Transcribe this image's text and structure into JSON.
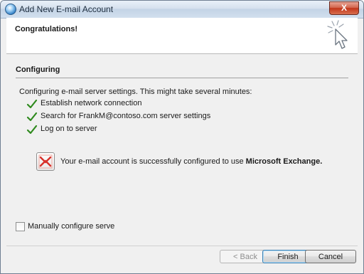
{
  "window": {
    "title": "Add New E-mail Account",
    "close_label": "X"
  },
  "header": {
    "title": "Congratulations!"
  },
  "section": {
    "title": "Configuring",
    "intro": "Configuring e-mail server settings.  This might take several minutes:"
  },
  "steps": [
    {
      "label": "Establish network connection",
      "status": "done"
    },
    {
      "label": "Search for FrankM@contoso.com server settings",
      "status": "done"
    },
    {
      "label": "Log on to server",
      "status": "done"
    }
  ],
  "result": {
    "text": "Your e-mail account is successfully configured to use ",
    "server": "Microsoft Exchange."
  },
  "manual": {
    "label": "Manually configure server settings",
    "checked": false
  },
  "buttons": {
    "back": "< Back",
    "finish": "Finish",
    "cancel": "Cancel"
  },
  "icons": {
    "app": "outlook-icon",
    "wizard": "wizard-sparkle-cursor-icon",
    "check": "green-checkmark-icon",
    "exchange": "exchange-icon"
  },
  "colors": {
    "check": "#2f8a1e",
    "exchange": "#d8312a"
  }
}
